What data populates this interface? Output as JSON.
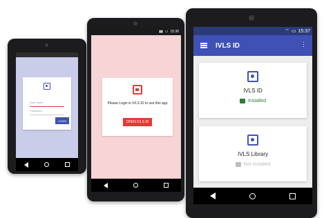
{
  "phone1": {
    "status_time": "",
    "login_card": {
      "username_placeholder": "User name",
      "password_placeholder": "Password",
      "login_label": "LOGIN"
    }
  },
  "phone2": {
    "status_time": "15:36",
    "message": "Please Login in IVLS ID to use this app",
    "open_button_label": "OPEN IVLS ID"
  },
  "phone3": {
    "status_time": "15:37",
    "app_title": "IVLS ID",
    "apps": [
      {
        "name": "IVLS ID",
        "status": "Installed",
        "status_color": "#2e7d32"
      },
      {
        "name": "IVLS Library",
        "status": "Not Installed",
        "status_color": "#bdbdbd"
      }
    ]
  },
  "colors": {
    "primary": "#3f51b5",
    "accent_red": "#e53935",
    "installed_green": "#2e7d32"
  }
}
